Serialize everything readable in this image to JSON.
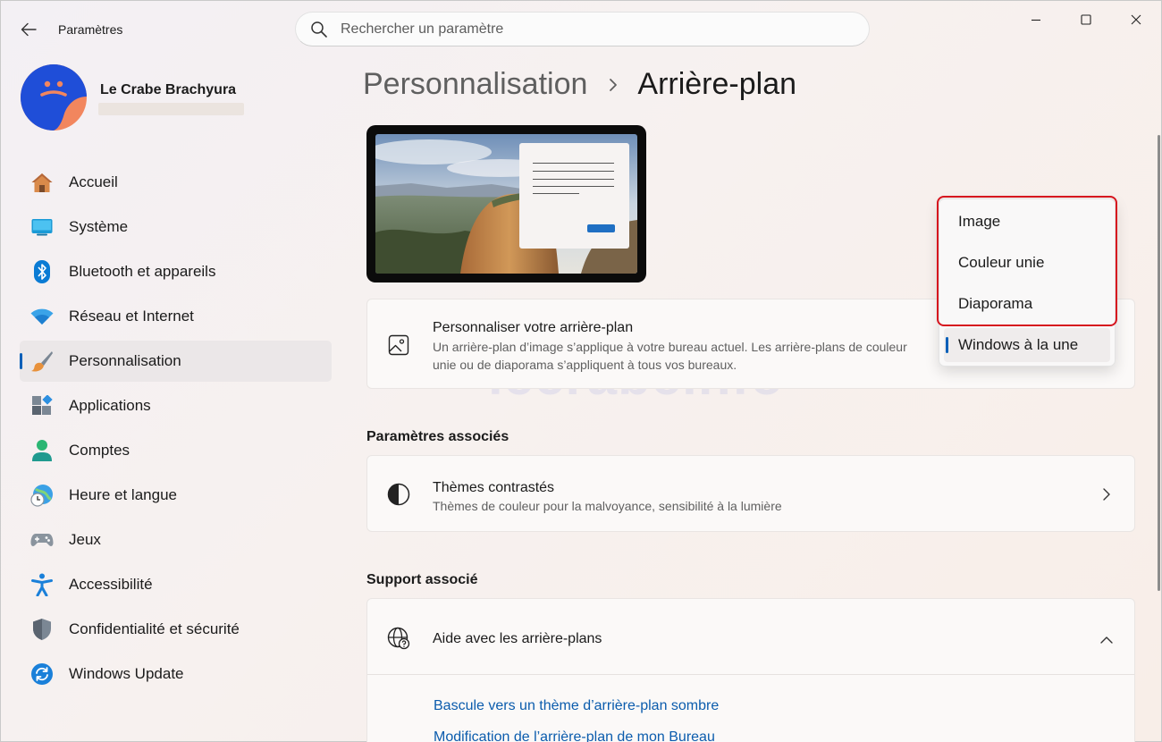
{
  "window": {
    "app_title": "Paramètres",
    "search_placeholder": "Rechercher un paramètre"
  },
  "user": {
    "name": "Le Crabe Brachyura"
  },
  "sidebar": {
    "items": [
      {
        "label": "Accueil",
        "icon": "home-icon"
      },
      {
        "label": "Système",
        "icon": "system-icon"
      },
      {
        "label": "Bluetooth et appareils",
        "icon": "bluetooth-icon"
      },
      {
        "label": "Réseau et Internet",
        "icon": "wifi-icon"
      },
      {
        "label": "Personnalisation",
        "icon": "brush-icon",
        "selected": true
      },
      {
        "label": "Applications",
        "icon": "apps-icon"
      },
      {
        "label": "Comptes",
        "icon": "account-icon"
      },
      {
        "label": "Heure et langue",
        "icon": "clock-globe-icon"
      },
      {
        "label": "Jeux",
        "icon": "gamepad-icon"
      },
      {
        "label": "Accessibilité",
        "icon": "accessibility-icon"
      },
      {
        "label": "Confidentialité et sécurité",
        "icon": "shield-icon"
      },
      {
        "label": "Windows Update",
        "icon": "update-icon"
      }
    ]
  },
  "breadcrumb": {
    "parent": "Personnalisation",
    "current": "Arrière-plan"
  },
  "background_card": {
    "title": "Personnaliser votre arrière-plan",
    "description": "Un arrière-plan d’image s’applique à votre bureau actuel. Les arrière-plans de couleur unie ou de diaporama s’appliquent à tous vos bureaux."
  },
  "dropdown": {
    "options": [
      "Image",
      "Couleur unie",
      "Diaporama",
      "Windows à la une"
    ],
    "selected": "Windows à la une"
  },
  "related_settings": {
    "title": "Paramètres associés",
    "contrast_title": "Thèmes contrastés",
    "contrast_desc": "Thèmes de couleur pour la malvoyance, sensibilité à la lumière"
  },
  "support": {
    "title": "Support associé",
    "help_title": "Aide avec les arrière-plans",
    "links": [
      "Bascule vers un thème d’arrière-plan sombre",
      "Modification de l’arrière-plan de mon Bureau"
    ]
  },
  "watermark": "lecrabeinfo",
  "colors": {
    "accent": "#005fb8",
    "link": "#0b5cad",
    "highlight": "#d6151e"
  }
}
